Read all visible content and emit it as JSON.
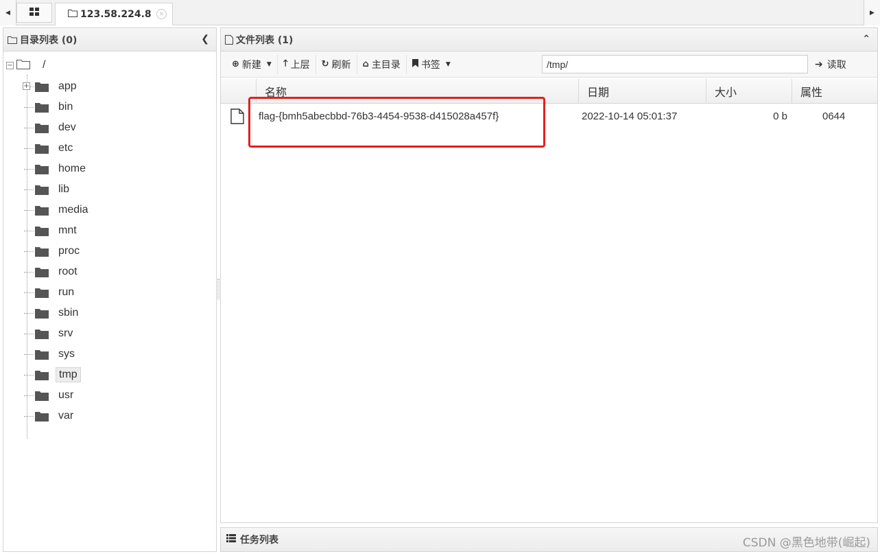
{
  "tabs": {
    "home_icon": "grid-icon",
    "active_tab_label": "123.58.224.8",
    "close_glyph": "×"
  },
  "left_panel": {
    "title": "目录列表 (0)",
    "root_label": "/",
    "folders": [
      "app",
      "bin",
      "dev",
      "etc",
      "home",
      "lib",
      "media",
      "mnt",
      "proc",
      "root",
      "run",
      "sbin",
      "srv",
      "sys",
      "tmp",
      "usr",
      "var"
    ],
    "selected": "tmp"
  },
  "right_panel": {
    "title": "文件列表 (1)",
    "toolbar": {
      "new_label": "新建",
      "up_label": "上层",
      "refresh_label": "刷新",
      "home_label": "主目录",
      "bookmark_label": "书签",
      "path_value": "/tmp/",
      "read_label": "读取"
    },
    "columns": [
      "名称",
      "日期",
      "大小",
      "属性"
    ],
    "rows": [
      {
        "name": "flag-{bmh5abecbbd-76b3-4454-9538-d415028a457f}",
        "date": "2022-10-14 05:01:37",
        "size": "0 b",
        "attr": "0644"
      }
    ]
  },
  "task_bar": {
    "title": "任务列表"
  },
  "watermark": "CSDN @黑色地带(崛起)",
  "colors": {
    "highlight": "#e02020",
    "border": "#d4d4d4"
  }
}
